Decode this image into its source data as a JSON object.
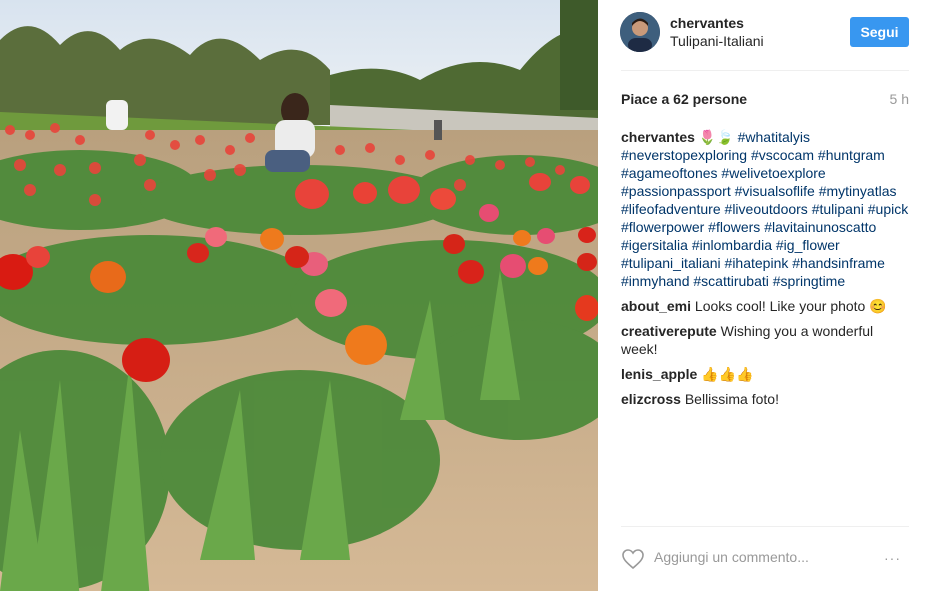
{
  "post": {
    "username": "chervantes",
    "location": "Tulipani-Italiani",
    "follow_label": "Segui",
    "likes": "Piace a 62 persone",
    "time_ago": "5 h",
    "caption": {
      "user": "chervantes",
      "emoji": "🌷🍃",
      "hashtags": [
        "#whatitalyis",
        "#neverstopexploring",
        "#vscocam",
        "#huntgram",
        "#agameoftones",
        "#welivetoexplore",
        "#passionpassport",
        "#visualsoflife",
        "#mytinyatlas",
        "#lifeofadventure",
        "#liveoutdoors",
        "#tulipani",
        "#upick",
        "#flowerpower",
        "#flowers",
        "#lavitainunoscatto",
        "#igersitalia",
        "#inlombardia",
        "#ig_flower",
        "#tulipani_italiani",
        "#ihatepink",
        "#handsinframe",
        "#inmyhand",
        "#scattirubati",
        "#springtime"
      ]
    },
    "comments": [
      {
        "user": "about_emi",
        "text": "Looks cool! Like your photo 😊"
      },
      {
        "user": "creativerepute",
        "text": "Wishing you a wonderful week!"
      },
      {
        "user": "lenis_apple",
        "text": "👍👍👍"
      },
      {
        "user": "elizcross",
        "text": "Bellissima foto!"
      }
    ],
    "add_comment_placeholder": "Aggiungi un commento...",
    "more_label": "···",
    "icons": {
      "like": "heart-icon",
      "more": "more-options-icon"
    }
  },
  "colors": {
    "accent": "#3897f0",
    "hashtag": "#003569",
    "muted": "#999999"
  }
}
